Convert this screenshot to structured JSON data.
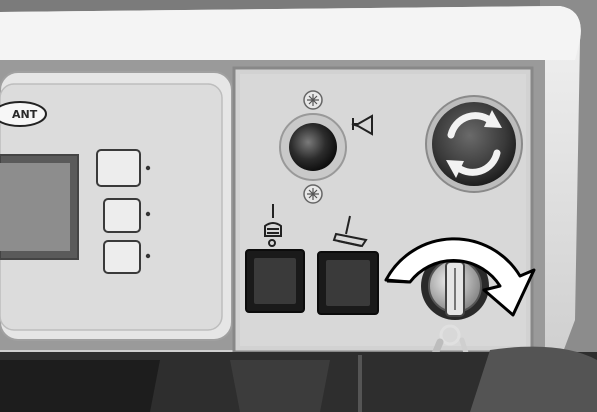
{
  "image": {
    "kind": "photo",
    "tone": "grayscale",
    "subject": "scrubber-machine-control-panel"
  },
  "brand_label_text": "ANT",
  "icons": {
    "horn": "horn-icon",
    "emergency_stop": "emergency-stop-rotate-arrows-icon",
    "vacuum": "vacuum-squeegee-icon",
    "brush": "floor-brush-icon",
    "screw": "screw-icon",
    "key_turn": "key-turn-arrow-icon"
  },
  "colors": {
    "background": "#6f6f6f",
    "panel": "#d9d9d9",
    "display_frame": "#e6e6e6",
    "estop": "#3a3a3a",
    "turn_arrow": "#ffffff"
  }
}
